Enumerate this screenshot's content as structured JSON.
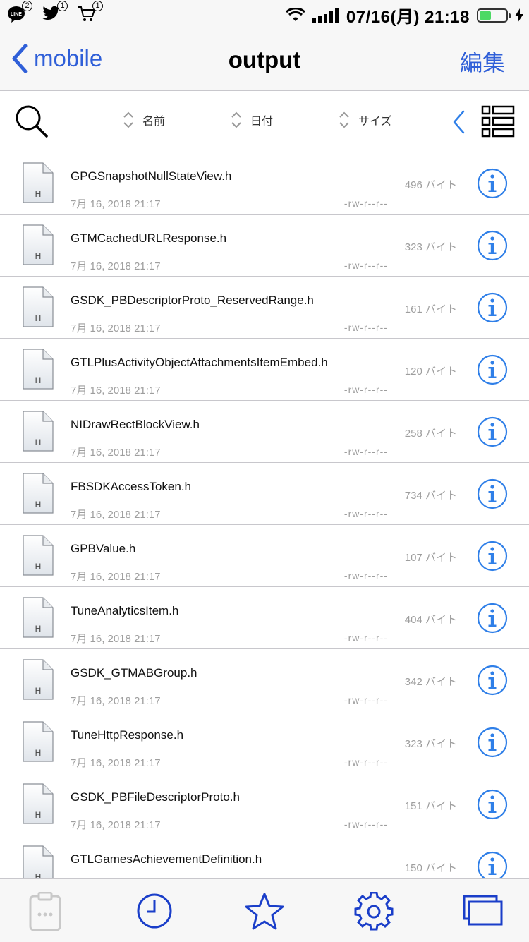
{
  "status_bar": {
    "apps": [
      {
        "name": "LINE",
        "badge": "2"
      },
      {
        "name": "Twitter",
        "badge": "1"
      },
      {
        "name": "Cart",
        "badge": "1"
      }
    ],
    "datetime": "07/16(月) 21:18",
    "battery_level": 0.45
  },
  "nav": {
    "back_label": "mobile",
    "title": "output",
    "edit_label": "編集"
  },
  "toolbar": {
    "sort_name": "名前",
    "sort_date": "日付",
    "sort_size": "サイズ"
  },
  "files": [
    {
      "name": "GPGSnapshotNullStateView.h",
      "date": "7月 16, 2018 21:17",
      "perm": "-rw-r--r--",
      "size": "496 バイト",
      "icon_label": "H"
    },
    {
      "name": "GTMCachedURLResponse.h",
      "date": "7月 16, 2018 21:17",
      "perm": "-rw-r--r--",
      "size": "323 バイト",
      "icon_label": "H"
    },
    {
      "name": "GSDK_PBDescriptorProto_ReservedRange.h",
      "date": "7月 16, 2018 21:17",
      "perm": "-rw-r--r--",
      "size": "161 バイト",
      "icon_label": "H"
    },
    {
      "name": "GTLPlusActivityObjectAttachmentsItemEmbed.h",
      "date": "7月 16, 2018 21:17",
      "perm": "-rw-r--r--",
      "size": "120 バイト",
      "icon_label": "H"
    },
    {
      "name": "NIDrawRectBlockView.h",
      "date": "7月 16, 2018 21:17",
      "perm": "-rw-r--r--",
      "size": "258 バイト",
      "icon_label": "H"
    },
    {
      "name": "FBSDKAccessToken.h",
      "date": "7月 16, 2018 21:17",
      "perm": "-rw-r--r--",
      "size": "734 バイト",
      "icon_label": "H"
    },
    {
      "name": "GPBValue.h",
      "date": "7月 16, 2018 21:17",
      "perm": "-rw-r--r--",
      "size": "107 バイト",
      "icon_label": "H"
    },
    {
      "name": "TuneAnalyticsItem.h",
      "date": "7月 16, 2018 21:17",
      "perm": "-rw-r--r--",
      "size": "404 バイト",
      "icon_label": "H"
    },
    {
      "name": "GSDK_GTMABGroup.h",
      "date": "7月 16, 2018 21:17",
      "perm": "-rw-r--r--",
      "size": "342 バイト",
      "icon_label": "H"
    },
    {
      "name": "TuneHttpResponse.h",
      "date": "7月 16, 2018 21:17",
      "perm": "-rw-r--r--",
      "size": "323 バイト",
      "icon_label": "H"
    },
    {
      "name": "GSDK_PBFileDescriptorProto.h",
      "date": "7月 16, 2018 21:17",
      "perm": "-rw-r--r--",
      "size": "151 バイト",
      "icon_label": "H"
    },
    {
      "name": "GTLGamesAchievementDefinition.h",
      "date": "",
      "perm": "",
      "size": "150 バイト",
      "icon_label": "H"
    }
  ],
  "tabs": [
    "clipboard-icon",
    "history-clock-icon",
    "favorites-star-icon",
    "settings-gear-icon",
    "windows-icon"
  ],
  "colors": {
    "accent": "#2f5fd8",
    "info": "#2f7fe8",
    "secondary_text": "#9e9e9e",
    "separator": "#c8c7cc"
  }
}
